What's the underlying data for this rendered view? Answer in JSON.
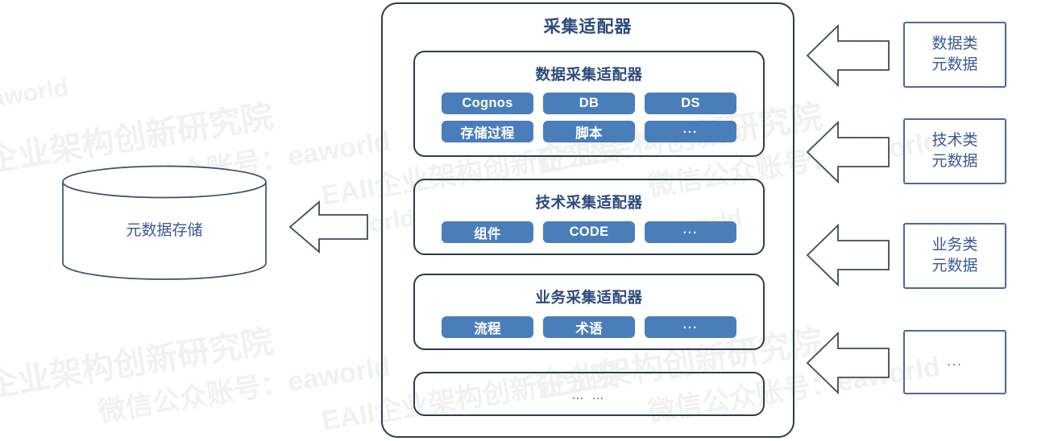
{
  "watermark": {
    "line1": "企业架构创新研究院",
    "line2": "微信公众账号：eaworld",
    "line3": "EAII企业架构创新研究院",
    "brand": "eaworld"
  },
  "store": {
    "label": "元数据存储",
    "icon": "database-cylinder-icon"
  },
  "outer": {
    "title": "采集适配器",
    "border_color": "#2c3c4f",
    "title_color": "#2c4a7c"
  },
  "groups": [
    {
      "id": "data-collection-adapter",
      "title": "数据采集适配器",
      "rows": [
        [
          "Cognos",
          "DB",
          "DS"
        ],
        [
          "存储过程",
          "脚本",
          "..."
        ]
      ]
    },
    {
      "id": "tech-collection-adapter",
      "title": "技术采集适配器",
      "rows": [
        [
          "组件",
          "CODE",
          "..."
        ]
      ]
    },
    {
      "id": "business-collection-adapter",
      "title": "业务采集适配器",
      "rows": [
        [
          "流程",
          "术语",
          "..."
        ]
      ]
    }
  ],
  "more_group": {
    "id": "more-adapters",
    "label": "… …"
  },
  "sources": [
    {
      "id": "data-metadata",
      "line1": "数据类",
      "line2": "元数据"
    },
    {
      "id": "tech-metadata",
      "line1": "技术类",
      "line2": "元数据"
    },
    {
      "id": "business-metadata",
      "line1": "业务类",
      "line2": "元数据"
    },
    {
      "id": "more-metadata",
      "line1": "...",
      "line2": ""
    }
  ],
  "colors": {
    "pill": "#4a7ebb",
    "pill_text": "#ffffff",
    "outline_dark": "#2c3c4f",
    "outline_blue": "#4c6a99",
    "text_blue": "#3a5a92",
    "title_blue": "#2c4a7c",
    "arrow_stroke": "#3c4a5c",
    "watermark": "#f1f1ef"
  }
}
